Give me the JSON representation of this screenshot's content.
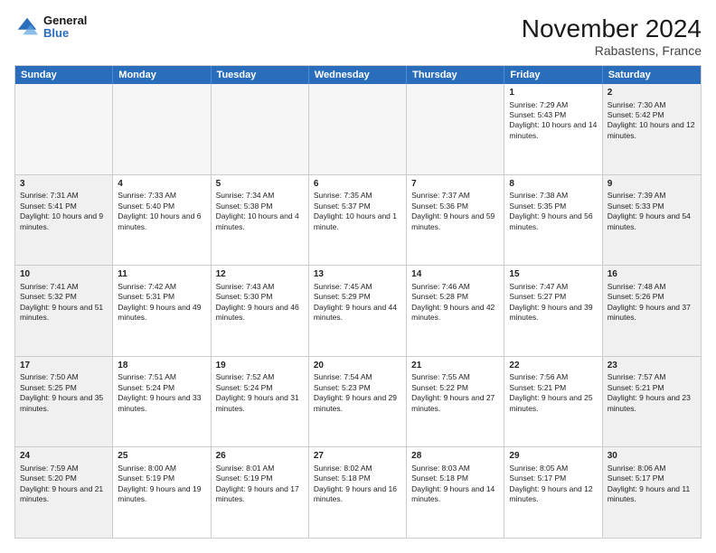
{
  "header": {
    "logo_line1": "General",
    "logo_line2": "Blue",
    "month": "November 2024",
    "location": "Rabastens, France"
  },
  "weekdays": [
    "Sunday",
    "Monday",
    "Tuesday",
    "Wednesday",
    "Thursday",
    "Friday",
    "Saturday"
  ],
  "weeks": [
    [
      {
        "day": "",
        "empty": true
      },
      {
        "day": "",
        "empty": true
      },
      {
        "day": "",
        "empty": true
      },
      {
        "day": "",
        "empty": true
      },
      {
        "day": "",
        "empty": true
      },
      {
        "day": "1",
        "sunrise": "Sunrise: 7:29 AM",
        "sunset": "Sunset: 5:43 PM",
        "daylight": "Daylight: 10 hours and 14 minutes."
      },
      {
        "day": "2",
        "sunrise": "Sunrise: 7:30 AM",
        "sunset": "Sunset: 5:42 PM",
        "daylight": "Daylight: 10 hours and 12 minutes."
      }
    ],
    [
      {
        "day": "3",
        "sunrise": "Sunrise: 7:31 AM",
        "sunset": "Sunset: 5:41 PM",
        "daylight": "Daylight: 10 hours and 9 minutes."
      },
      {
        "day": "4",
        "sunrise": "Sunrise: 7:33 AM",
        "sunset": "Sunset: 5:40 PM",
        "daylight": "Daylight: 10 hours and 6 minutes."
      },
      {
        "day": "5",
        "sunrise": "Sunrise: 7:34 AM",
        "sunset": "Sunset: 5:38 PM",
        "daylight": "Daylight: 10 hours and 4 minutes."
      },
      {
        "day": "6",
        "sunrise": "Sunrise: 7:35 AM",
        "sunset": "Sunset: 5:37 PM",
        "daylight": "Daylight: 10 hours and 1 minute."
      },
      {
        "day": "7",
        "sunrise": "Sunrise: 7:37 AM",
        "sunset": "Sunset: 5:36 PM",
        "daylight": "Daylight: 9 hours and 59 minutes."
      },
      {
        "day": "8",
        "sunrise": "Sunrise: 7:38 AM",
        "sunset": "Sunset: 5:35 PM",
        "daylight": "Daylight: 9 hours and 56 minutes."
      },
      {
        "day": "9",
        "sunrise": "Sunrise: 7:39 AM",
        "sunset": "Sunset: 5:33 PM",
        "daylight": "Daylight: 9 hours and 54 minutes."
      }
    ],
    [
      {
        "day": "10",
        "sunrise": "Sunrise: 7:41 AM",
        "sunset": "Sunset: 5:32 PM",
        "daylight": "Daylight: 9 hours and 51 minutes."
      },
      {
        "day": "11",
        "sunrise": "Sunrise: 7:42 AM",
        "sunset": "Sunset: 5:31 PM",
        "daylight": "Daylight: 9 hours and 49 minutes."
      },
      {
        "day": "12",
        "sunrise": "Sunrise: 7:43 AM",
        "sunset": "Sunset: 5:30 PM",
        "daylight": "Daylight: 9 hours and 46 minutes."
      },
      {
        "day": "13",
        "sunrise": "Sunrise: 7:45 AM",
        "sunset": "Sunset: 5:29 PM",
        "daylight": "Daylight: 9 hours and 44 minutes."
      },
      {
        "day": "14",
        "sunrise": "Sunrise: 7:46 AM",
        "sunset": "Sunset: 5:28 PM",
        "daylight": "Daylight: 9 hours and 42 minutes."
      },
      {
        "day": "15",
        "sunrise": "Sunrise: 7:47 AM",
        "sunset": "Sunset: 5:27 PM",
        "daylight": "Daylight: 9 hours and 39 minutes."
      },
      {
        "day": "16",
        "sunrise": "Sunrise: 7:48 AM",
        "sunset": "Sunset: 5:26 PM",
        "daylight": "Daylight: 9 hours and 37 minutes."
      }
    ],
    [
      {
        "day": "17",
        "sunrise": "Sunrise: 7:50 AM",
        "sunset": "Sunset: 5:25 PM",
        "daylight": "Daylight: 9 hours and 35 minutes."
      },
      {
        "day": "18",
        "sunrise": "Sunrise: 7:51 AM",
        "sunset": "Sunset: 5:24 PM",
        "daylight": "Daylight: 9 hours and 33 minutes."
      },
      {
        "day": "19",
        "sunrise": "Sunrise: 7:52 AM",
        "sunset": "Sunset: 5:24 PM",
        "daylight": "Daylight: 9 hours and 31 minutes."
      },
      {
        "day": "20",
        "sunrise": "Sunrise: 7:54 AM",
        "sunset": "Sunset: 5:23 PM",
        "daylight": "Daylight: 9 hours and 29 minutes."
      },
      {
        "day": "21",
        "sunrise": "Sunrise: 7:55 AM",
        "sunset": "Sunset: 5:22 PM",
        "daylight": "Daylight: 9 hours and 27 minutes."
      },
      {
        "day": "22",
        "sunrise": "Sunrise: 7:56 AM",
        "sunset": "Sunset: 5:21 PM",
        "daylight": "Daylight: 9 hours and 25 minutes."
      },
      {
        "day": "23",
        "sunrise": "Sunrise: 7:57 AM",
        "sunset": "Sunset: 5:21 PM",
        "daylight": "Daylight: 9 hours and 23 minutes."
      }
    ],
    [
      {
        "day": "24",
        "sunrise": "Sunrise: 7:59 AM",
        "sunset": "Sunset: 5:20 PM",
        "daylight": "Daylight: 9 hours and 21 minutes."
      },
      {
        "day": "25",
        "sunrise": "Sunrise: 8:00 AM",
        "sunset": "Sunset: 5:19 PM",
        "daylight": "Daylight: 9 hours and 19 minutes."
      },
      {
        "day": "26",
        "sunrise": "Sunrise: 8:01 AM",
        "sunset": "Sunset: 5:19 PM",
        "daylight": "Daylight: 9 hours and 17 minutes."
      },
      {
        "day": "27",
        "sunrise": "Sunrise: 8:02 AM",
        "sunset": "Sunset: 5:18 PM",
        "daylight": "Daylight: 9 hours and 16 minutes."
      },
      {
        "day": "28",
        "sunrise": "Sunrise: 8:03 AM",
        "sunset": "Sunset: 5:18 PM",
        "daylight": "Daylight: 9 hours and 14 minutes."
      },
      {
        "day": "29",
        "sunrise": "Sunrise: 8:05 AM",
        "sunset": "Sunset: 5:17 PM",
        "daylight": "Daylight: 9 hours and 12 minutes."
      },
      {
        "day": "30",
        "sunrise": "Sunrise: 8:06 AM",
        "sunset": "Sunset: 5:17 PM",
        "daylight": "Daylight: 9 hours and 11 minutes."
      }
    ]
  ]
}
